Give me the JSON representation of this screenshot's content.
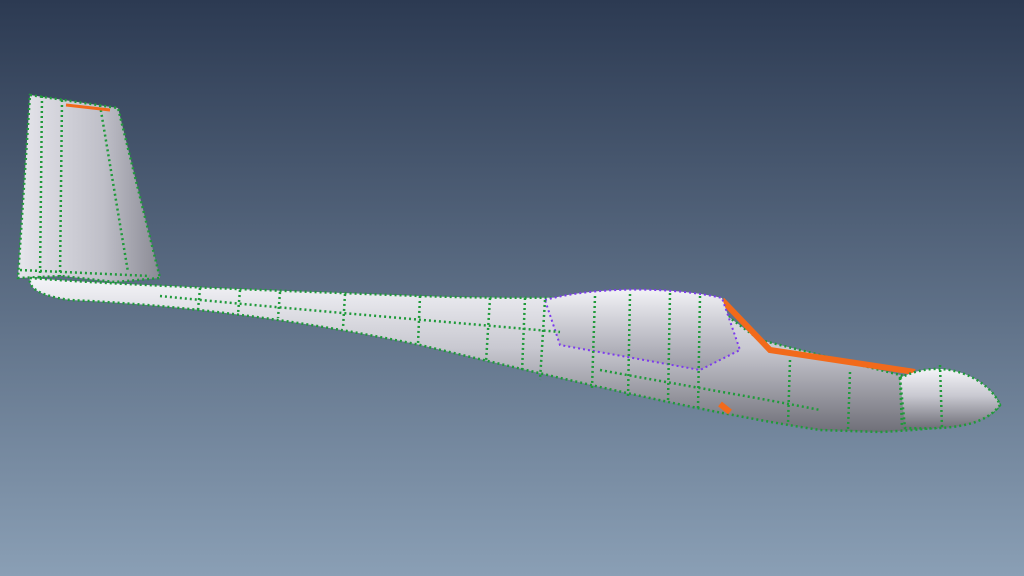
{
  "viewport": {
    "background_top": "#2c3a52",
    "background_bottom": "#8a9fb5"
  },
  "model": {
    "subject": "glider-fuselage-mesh",
    "surface_color": "#c9c9d1",
    "edge_line_color": "#1f9a3a",
    "node_color_primary": "#22c55e",
    "node_color_secondary": "#7c3aed",
    "accent_color": "#f26a1b"
  }
}
